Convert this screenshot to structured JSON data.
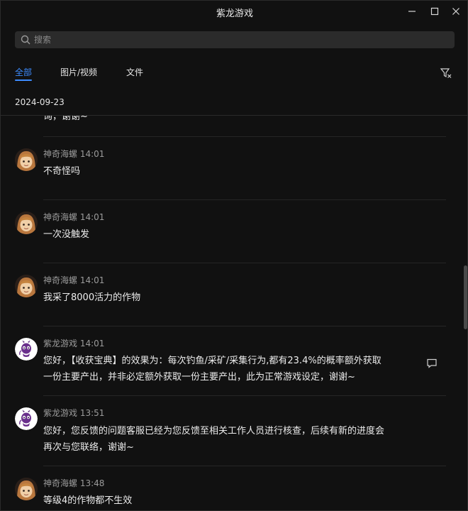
{
  "window": {
    "title": "紫龙游戏"
  },
  "search": {
    "placeholder": "搜索"
  },
  "tabs": [
    {
      "label": "全部",
      "active": true
    },
    {
      "label": "图片/视频",
      "active": false
    },
    {
      "label": "文件",
      "active": false
    }
  ],
  "date": "2024-09-23",
  "partial_top": {
    "text": "询，谢谢~"
  },
  "messages": [
    {
      "sender": "神奇海螺",
      "time": "14:01",
      "lines": [
        "不奇怪吗"
      ],
      "avatar": "user-avatar"
    },
    {
      "sender": "神奇海螺",
      "time": "14:01",
      "lines": [
        "一次没触发"
      ],
      "avatar": "user-avatar"
    },
    {
      "sender": "神奇海螺",
      "time": "14:01",
      "lines": [
        "我采了8000活力的作物"
      ],
      "avatar": "user-avatar"
    },
    {
      "sender": "紫龙游戏",
      "time": "14:01",
      "lines": [
        "您好，【收获宝典】的效果为：每次钓鱼/采矿/采集行为,都有23.4%的概率额外获取",
        "一份主要产出，并非必定额外获取一份主要产出，此为正常游戏设定，谢谢~"
      ],
      "avatar": "dragon-avatar"
    },
    {
      "sender": "紫龙游戏",
      "time": "13:51",
      "lines": [
        "您好，您反馈的问题客服已经为您反馈至相关工作人员进行核查，后续有新的进度会",
        "再次与您联络，谢谢~"
      ],
      "avatar": "dragon-avatar"
    },
    {
      "sender": "神奇海螺",
      "time": "13:48",
      "lines": [
        "等级4的作物都不生效"
      ],
      "avatar": "user-avatar"
    }
  ],
  "colors": {
    "accent": "#3d8cff",
    "background": "#111111",
    "search_bg": "#2b2b2b"
  },
  "icons": [
    "search-icon",
    "minimize-icon",
    "maximize-icon",
    "close-icon",
    "filter-icon",
    "reply-icon"
  ]
}
